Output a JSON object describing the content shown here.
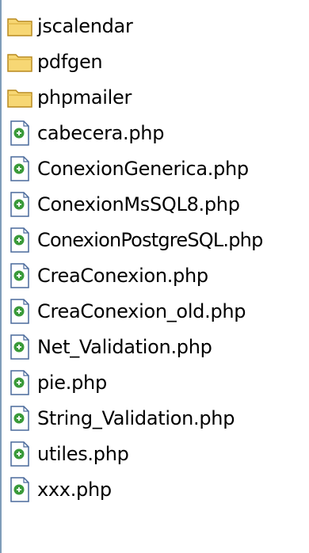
{
  "colors": {
    "folder_fill": "#f7d774",
    "folder_stroke": "#b88a1f",
    "php_icon_bg": "#ffffff",
    "php_icon_border": "#4a6a9b",
    "php_badge": "#3a9a3a",
    "text": "#000000"
  },
  "items": [
    {
      "label": "jscalendar",
      "type": "folder",
      "icon": "folder-icon"
    },
    {
      "label": "pdfgen",
      "type": "folder",
      "icon": "folder-icon"
    },
    {
      "label": "phpmailer",
      "type": "folder",
      "icon": "folder-icon"
    },
    {
      "label": "cabecera.php",
      "type": "file",
      "icon": "php-file-icon"
    },
    {
      "label": "ConexionGenerica.php",
      "type": "file",
      "icon": "php-file-icon"
    },
    {
      "label": "ConexionMsSQL8.php",
      "type": "file",
      "icon": "php-file-icon"
    },
    {
      "label": "ConexionPostgreSQL.php",
      "type": "file",
      "icon": "php-file-icon"
    },
    {
      "label": "CreaConexion.php",
      "type": "file",
      "icon": "php-file-icon"
    },
    {
      "label": "CreaConexion_old.php",
      "type": "file",
      "icon": "php-file-icon"
    },
    {
      "label": "Net_Validation.php",
      "type": "file",
      "icon": "php-file-icon"
    },
    {
      "label": "pie.php",
      "type": "file",
      "icon": "php-file-icon"
    },
    {
      "label": "String_Validation.php",
      "type": "file",
      "icon": "php-file-icon"
    },
    {
      "label": "utiles.php",
      "type": "file",
      "icon": "php-file-icon"
    },
    {
      "label": "xxx.php",
      "type": "file",
      "icon": "php-file-icon"
    }
  ]
}
